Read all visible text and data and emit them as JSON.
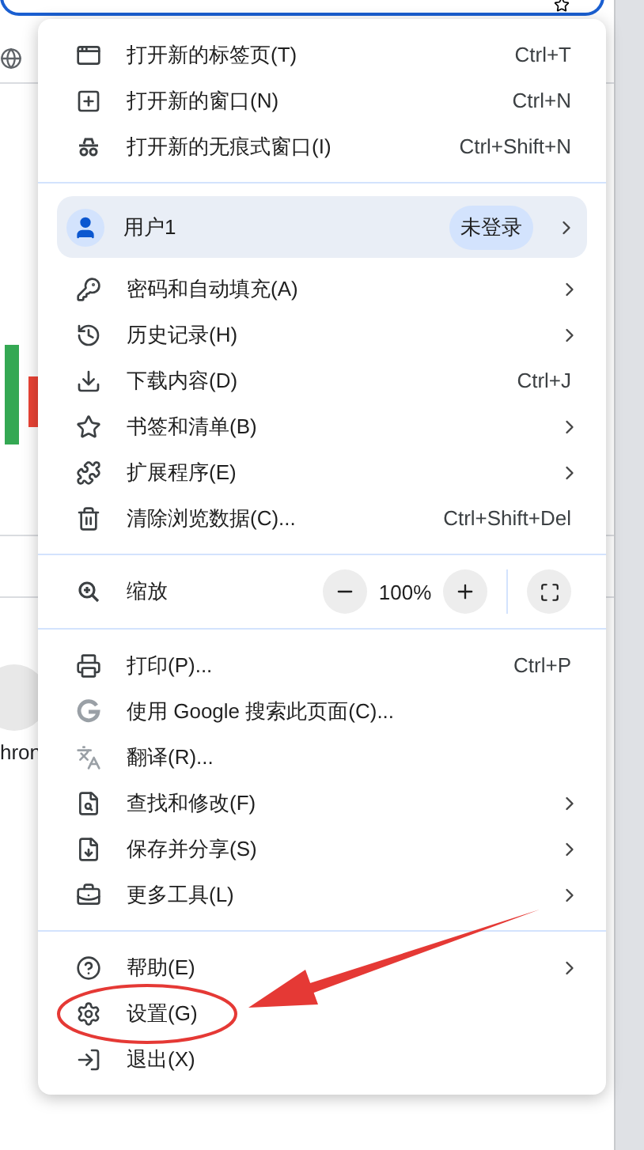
{
  "page": {
    "fragment_text": "hron"
  },
  "menu": {
    "sections": [
      {
        "rows": [
          {
            "kind": "item",
            "label": "打开新的标签页(T)",
            "shortcut": "Ctrl+T"
          },
          {
            "kind": "item",
            "label": "打开新的窗口(N)",
            "shortcut": "Ctrl+N"
          },
          {
            "kind": "item",
            "label": "打开新的无痕式窗口(I)",
            "shortcut": "Ctrl+Shift+N"
          }
        ]
      },
      {
        "rows": [
          {
            "kind": "profile",
            "label": "用户1",
            "badge": "未登录",
            "submenu": true
          },
          {
            "kind": "item",
            "label": "密码和自动填充(A)",
            "submenu": true
          },
          {
            "kind": "item",
            "label": "历史记录(H)",
            "submenu": true
          },
          {
            "kind": "item",
            "label": "下载内容(D)",
            "shortcut": "Ctrl+J"
          },
          {
            "kind": "item",
            "label": "书签和清单(B)",
            "submenu": true
          },
          {
            "kind": "item",
            "label": "扩展程序(E)",
            "submenu": true
          },
          {
            "kind": "item",
            "label": "清除浏览数据(C)...",
            "shortcut": "Ctrl+Shift+Del"
          }
        ]
      },
      {
        "rows": [
          {
            "kind": "zoom",
            "label": "缩放",
            "value": "100%"
          }
        ]
      },
      {
        "rows": [
          {
            "kind": "item",
            "label": "打印(P)...",
            "shortcut": "Ctrl+P"
          },
          {
            "kind": "item",
            "label": "使用 Google 搜索此页面(C)..."
          },
          {
            "kind": "item",
            "label": "翻译(R)..."
          },
          {
            "kind": "item",
            "label": "查找和修改(F)",
            "submenu": true
          },
          {
            "kind": "item",
            "label": "保存并分享(S)",
            "submenu": true
          },
          {
            "kind": "item",
            "label": "更多工具(L)",
            "submenu": true
          }
        ]
      },
      {
        "rows": [
          {
            "kind": "item",
            "label": "帮助(E)",
            "submenu": true
          },
          {
            "kind": "item",
            "label": "设置(G)"
          },
          {
            "kind": "item",
            "label": "退出(X)"
          }
        ]
      }
    ]
  }
}
